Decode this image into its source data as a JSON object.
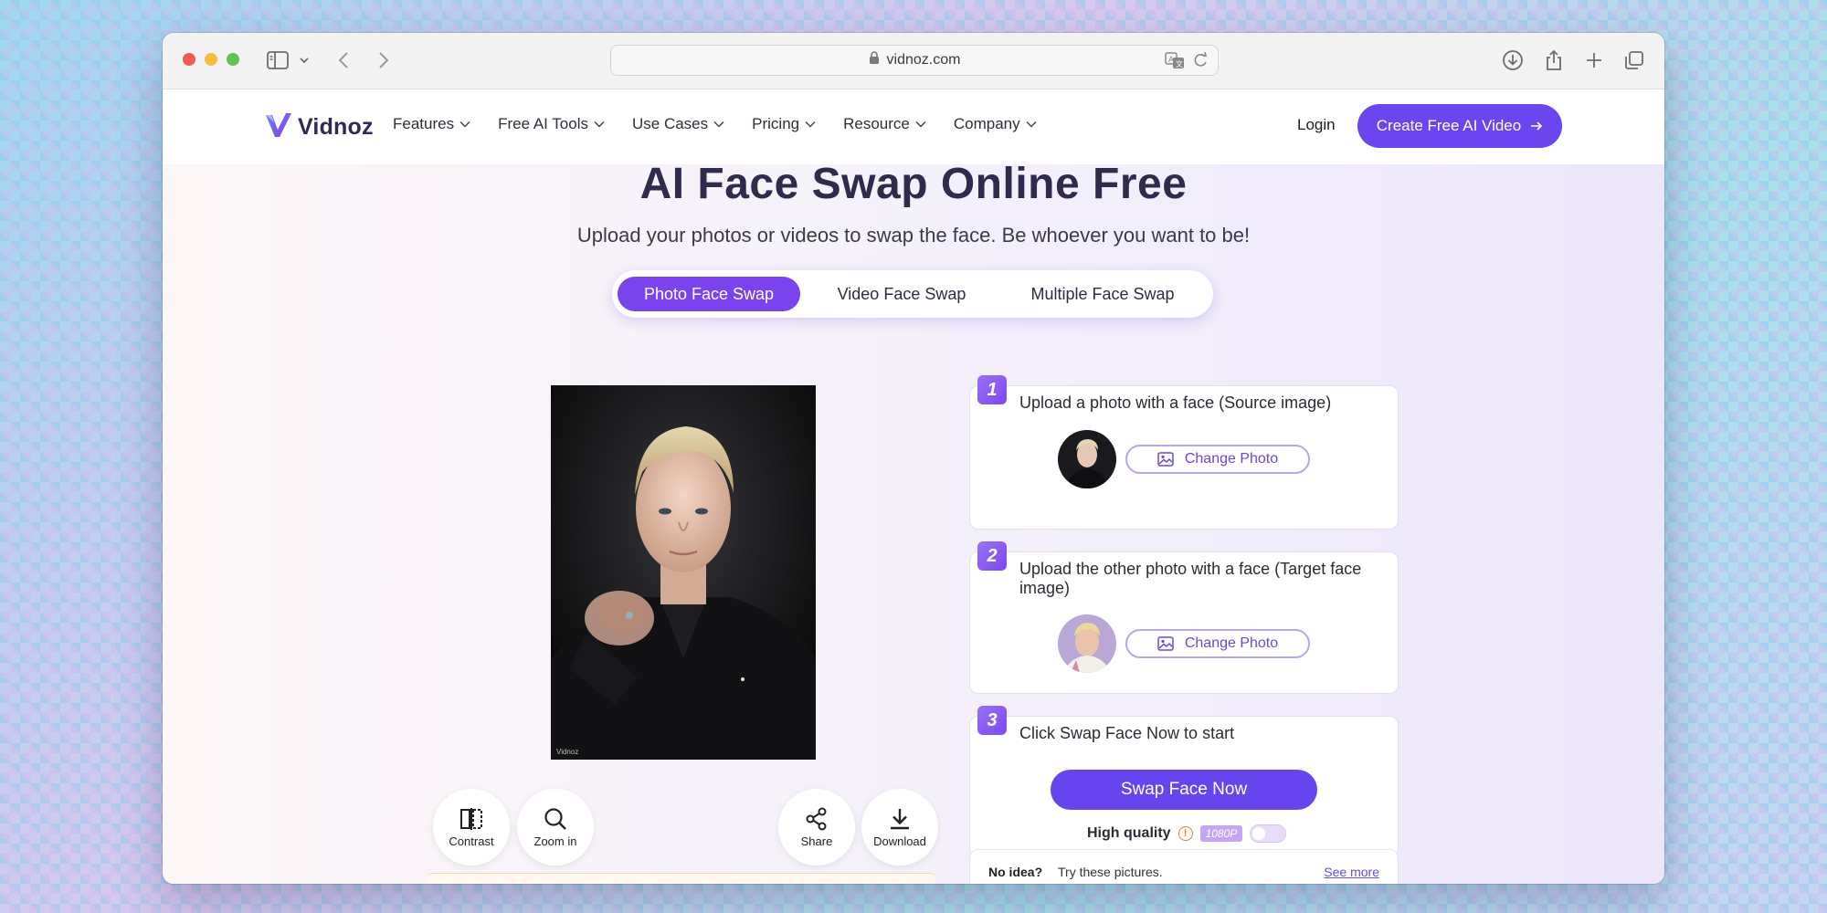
{
  "browser": {
    "url": "vidnoz.com"
  },
  "header": {
    "logo_text": "Vidnoz",
    "nav": [
      {
        "label": "Features"
      },
      {
        "label": "Free AI Tools"
      },
      {
        "label": "Use Cases"
      },
      {
        "label": "Pricing"
      },
      {
        "label": "Resource"
      },
      {
        "label": "Company"
      }
    ],
    "login_label": "Login",
    "cta_label": "Create Free AI Video"
  },
  "hero": {
    "title": "AI Face Swap Online Free",
    "subtitle": "Upload your photos or videos to swap the face. Be whoever you want to be!"
  },
  "tabs": [
    {
      "label": "Photo Face Swap",
      "active": true
    },
    {
      "label": "Video Face Swap",
      "active": false
    },
    {
      "label": "Multiple Face Swap",
      "active": false
    }
  ],
  "preview": {
    "watermark": "Vidnoz"
  },
  "tools": {
    "contrast": "Contrast",
    "zoom": "Zoom in",
    "share": "Share",
    "download": "Download"
  },
  "steps": [
    {
      "number": "1",
      "text": "Upload a photo with a face (Source image)",
      "button": "Change Photo"
    },
    {
      "number": "2",
      "text": "Upload the other photo with a face (Target face image)",
      "button": "Change Photo"
    },
    {
      "number": "3",
      "text": "Click Swap Face Now to start",
      "button": "Swap Face Now"
    }
  ],
  "quality": {
    "label": "High quality",
    "badge": "1080P",
    "enabled": false
  },
  "suggestions": {
    "lead": "No idea?",
    "text": "Try these pictures.",
    "link": "See more"
  },
  "colors": {
    "brand": "#6a45f0",
    "accent": "#7b43ee"
  }
}
